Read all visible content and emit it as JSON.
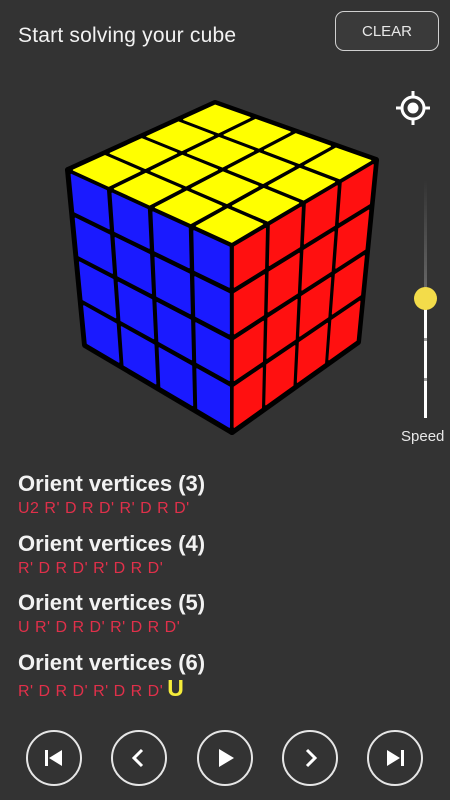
{
  "header": {
    "title": "Start solving your cube",
    "clear_label": "CLEAR"
  },
  "icons": {
    "locate": "crosshair-locate-icon",
    "first": "skip-to-start-icon",
    "prev": "chevron-left-icon",
    "play": "play-icon",
    "next": "chevron-right-icon",
    "last": "skip-to-end-icon"
  },
  "cube": {
    "faces_visible": [
      "top",
      "front",
      "right"
    ],
    "colors": {
      "top": "#ffff00",
      "front": "#1a1aff",
      "right": "#ff1010",
      "edges": "#000000"
    },
    "size": "4x4"
  },
  "speed": {
    "label": "Speed",
    "value_fraction": 0.5
  },
  "steps": [
    {
      "title": "Orient vertices (3)",
      "moves": "U2 R' D R D' R' D R D'",
      "current": ""
    },
    {
      "title": "Orient vertices (4)",
      "moves": "R' D R D' R' D R D'",
      "current": ""
    },
    {
      "title": "Orient vertices (5)",
      "moves": "U R' D R D' R' D R D'",
      "current": ""
    },
    {
      "title": "Orient vertices (6)",
      "moves": "R' D R D' R' D R D'",
      "current": "U"
    }
  ],
  "colors": {
    "background": "#333333",
    "move_text": "#e0304a",
    "current_move": "#f5ec3a",
    "slider_thumb": "#f3dc4a"
  }
}
